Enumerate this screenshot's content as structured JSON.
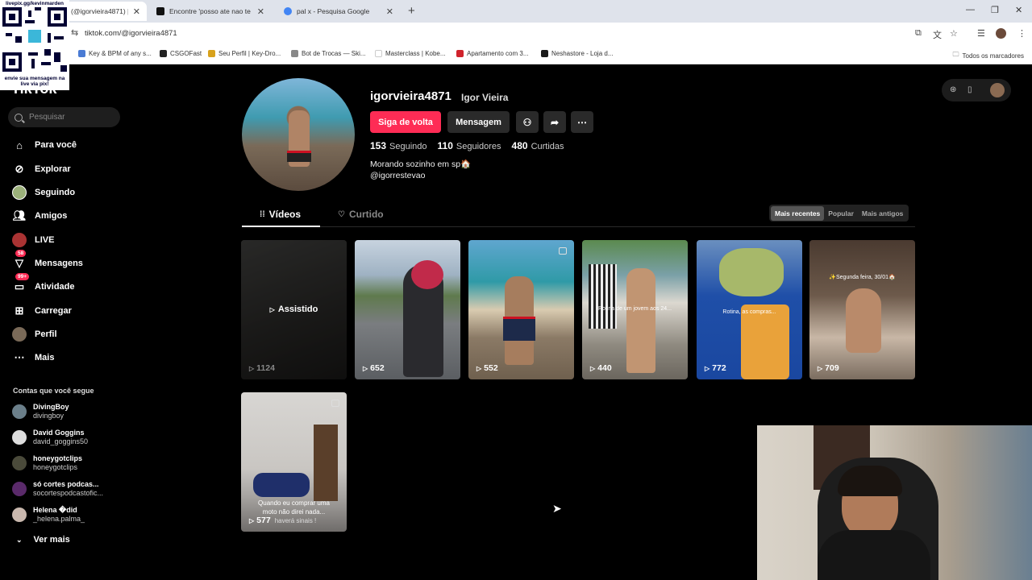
{
  "browser": {
    "tabs": [
      {
        "label": "(@igorvieira4871) | T",
        "active": true
      },
      {
        "label": "Encontre 'posso ate nao te da'",
        "active": false
      },
      {
        "label": "pal x - Pesquisa Google",
        "active": false
      }
    ],
    "url": "tiktok.com/@igorvieira4871",
    "bookmarks": [
      "Key & BPM of any s...",
      "CSGOFast",
      "Seu Perfil | Key-Dro...",
      "Bot de Trocas — Ski...",
      "Masterclass | Kobe...",
      "Apartamento com 3...",
      "Neshastore - Loja d..."
    ],
    "all_bookmarks": "Todos os marcadores"
  },
  "overlay": {
    "text_line1": "livepix.gg/kevinmarden",
    "text_line2": "envie sua mensagem na",
    "text_line3": "live via pix!"
  },
  "sidebar": {
    "logo": "TikTok",
    "search_placeholder": "Pesquisar",
    "nav": [
      {
        "label": "Para você",
        "icon": "home-icon"
      },
      {
        "label": "Explorar",
        "icon": "compass-icon"
      },
      {
        "label": "Seguindo",
        "icon": "following-avatar"
      },
      {
        "label": "Amigos",
        "icon": "friends-icon"
      },
      {
        "label": "LIVE",
        "icon": "live-icon"
      },
      {
        "label": "Mensagens",
        "icon": "messages-icon",
        "badge": "58"
      },
      {
        "label": "Atividade",
        "icon": "activity-icon",
        "badge": "99+"
      },
      {
        "label": "Carregar",
        "icon": "upload-icon"
      },
      {
        "label": "Perfil",
        "icon": "profile-avatar"
      },
      {
        "label": "Mais",
        "icon": "more-icon"
      }
    ],
    "following_title": "Contas que você segue",
    "following": [
      {
        "name": "DivingBoy",
        "handle": "divingboy"
      },
      {
        "name": "David Goggins",
        "handle": "david_goggins50"
      },
      {
        "name": "honeygotclips",
        "handle": "honeygotclips"
      },
      {
        "name": "só cortes podcas...",
        "handle": "socortespodcastofic..."
      },
      {
        "name": "Helena �did",
        "handle": "_helena.palma_"
      }
    ],
    "see_more": "Ver mais"
  },
  "profile": {
    "username": "igorvieira4871",
    "display_name": "Igor Vieira",
    "follow_back": "Siga de volta",
    "message": "Mensagem",
    "following_count": "153",
    "following_label": "Seguindo",
    "followers_count": "110",
    "followers_label": "Seguidores",
    "likes_count": "480",
    "likes_label": "Curtidas",
    "bio_line1": "Morando sozinho em sp🏠",
    "bio_line2": "@igorrestevao"
  },
  "tabs": {
    "videos": "Vídeos",
    "liked": "Curtido"
  },
  "sort": {
    "recent": "Mais recentes",
    "popular": "Popular",
    "oldest": "Mais antigos"
  },
  "videos": [
    {
      "views": "1124",
      "watched": "Assistido"
    },
    {
      "views": "652"
    },
    {
      "views": "552"
    },
    {
      "views": "440",
      "caption": "Rotina de um jovem aos 24..."
    },
    {
      "views": "772",
      "caption": "Rotina, as compras..."
    },
    {
      "views": "709",
      "caption": "✨Segunda feira, 30/01🏠"
    },
    {
      "views": "577",
      "caption_line1": "Quando eu comprar uma",
      "caption_line2": "moto não direi nada...",
      "caption_line3": "haverá sinais !"
    }
  ],
  "colors": {
    "accent": "#fe2c55",
    "background": "#000000"
  }
}
